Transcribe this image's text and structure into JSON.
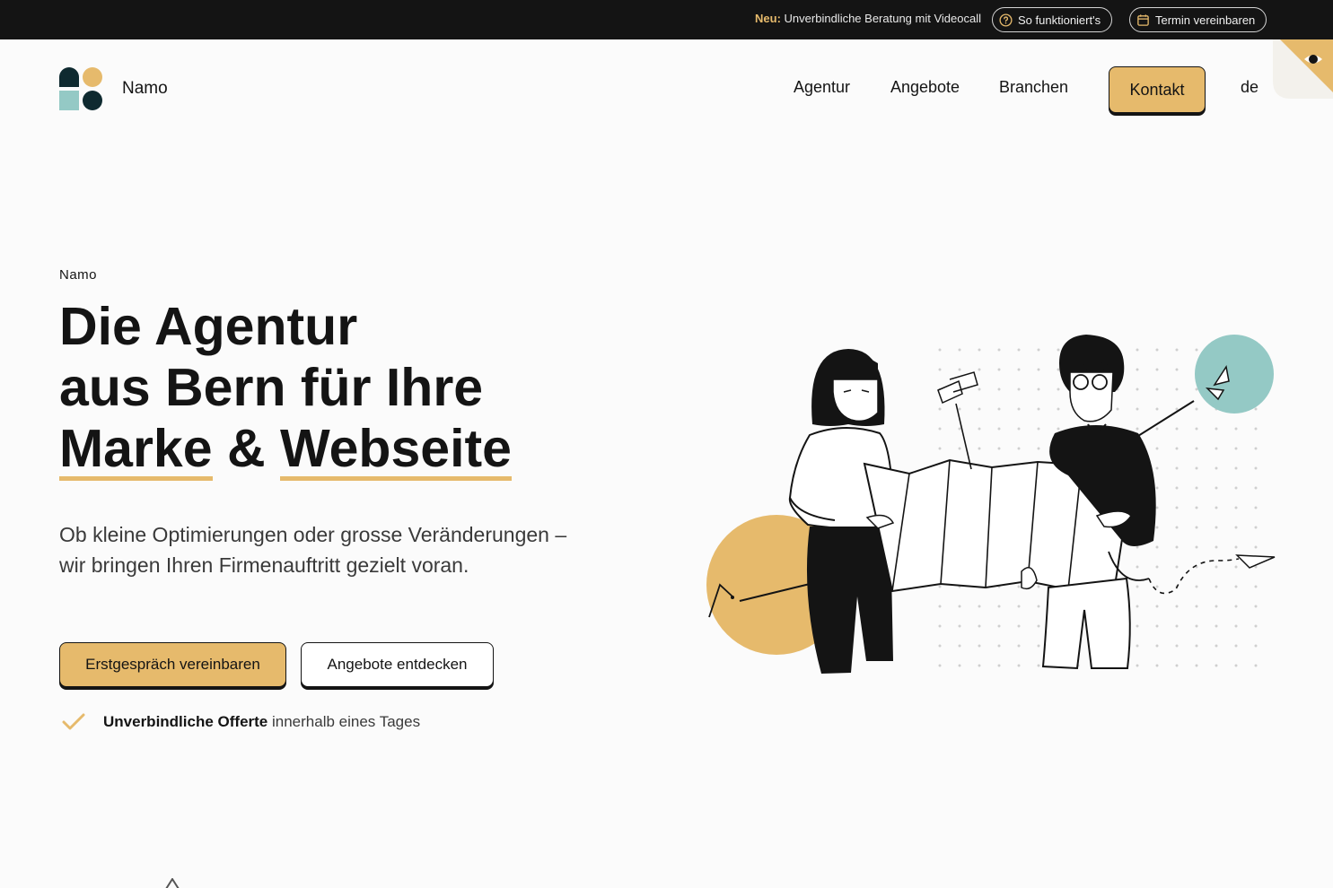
{
  "topbar": {
    "new_label": "Neu:",
    "announcement": "Unverbindliche Beratung mit Videocall",
    "howto_label": "So funktioniert's",
    "howto_icon": "question-circle-icon",
    "appointment_label": "Termin vereinbaren",
    "appointment_icon": "calendar-icon"
  },
  "header": {
    "brand": "Namo",
    "nav": {
      "agentur": "Agentur",
      "angebote": "Angebote",
      "branchen": "Branchen",
      "kontakt": "Kontakt",
      "language": "de"
    }
  },
  "hero": {
    "eyebrow": "Namo",
    "headline_line1": "Die Agentur",
    "headline_line2": "aus Bern für Ihre",
    "headline_word1": "Marke",
    "headline_amp": "&",
    "headline_word2": "Webseite",
    "lead": "Ob kleine Optimierungen oder grosse Veränderungen – wir bringen Ihren Firmenauftritt gezielt voran.",
    "cta_primary": "Erstgespräch vereinbaren",
    "cta_secondary": "Angebote entdecken",
    "offer_strong": "Unverbindliche Offerte",
    "offer_rest": " innerhalb eines Tages"
  },
  "colors": {
    "accent": "#e6ba6c",
    "teal": "#94c9c5",
    "dark": "#141414",
    "background": "#fbfbfb"
  }
}
